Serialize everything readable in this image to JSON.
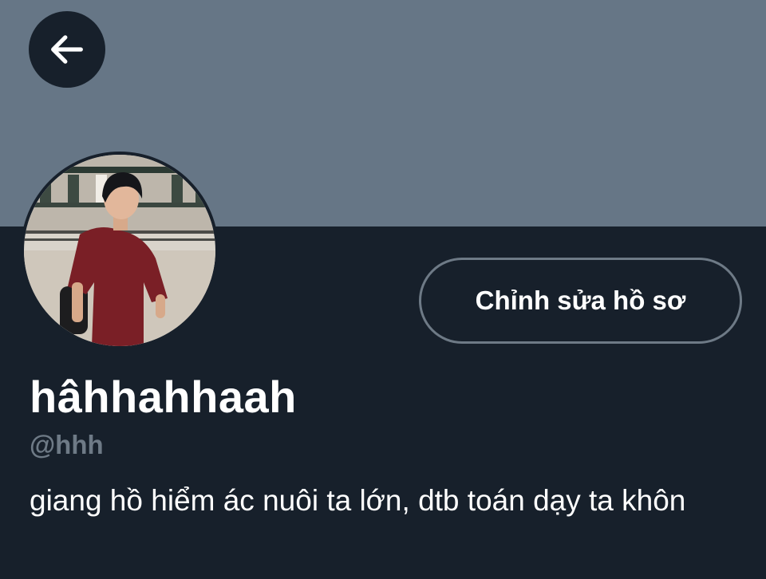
{
  "header": {
    "back_icon": "arrow-left-icon",
    "banner_color": "#667686"
  },
  "profile": {
    "avatar_alt": "Profile photo",
    "edit_button_label": "Chỉnh sửa hồ sơ",
    "display_name": "hâhhahhaah",
    "handle": "@hhh",
    "bio": "giang hồ hiểm ác nuôi ta lớn, dtb toán dạy ta khôn"
  },
  "colors": {
    "background": "#17202b",
    "text_primary": "#ffffff",
    "text_secondary": "#6e7a86",
    "button_border": "#6e7a86"
  }
}
